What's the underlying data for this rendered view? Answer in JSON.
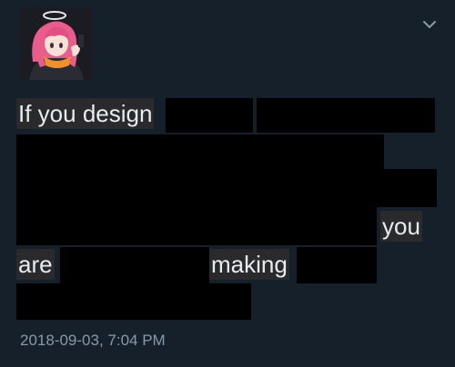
{
  "tweet": {
    "avatar_icon": "user-avatar-anime-girl",
    "menu_icon": "chevron-down-icon",
    "text_fragments": {
      "line1": "If you design",
      "line4_end": "you",
      "line5_start": "are",
      "line5_middle": "making"
    },
    "timestamp": "2018-09-03, 7:04 PM"
  },
  "colors": {
    "background": "#15202b",
    "text": "#e7ecf0",
    "muted_text": "#8899a6",
    "redaction": "#000000",
    "text_highlight": "#2a2a2c"
  }
}
